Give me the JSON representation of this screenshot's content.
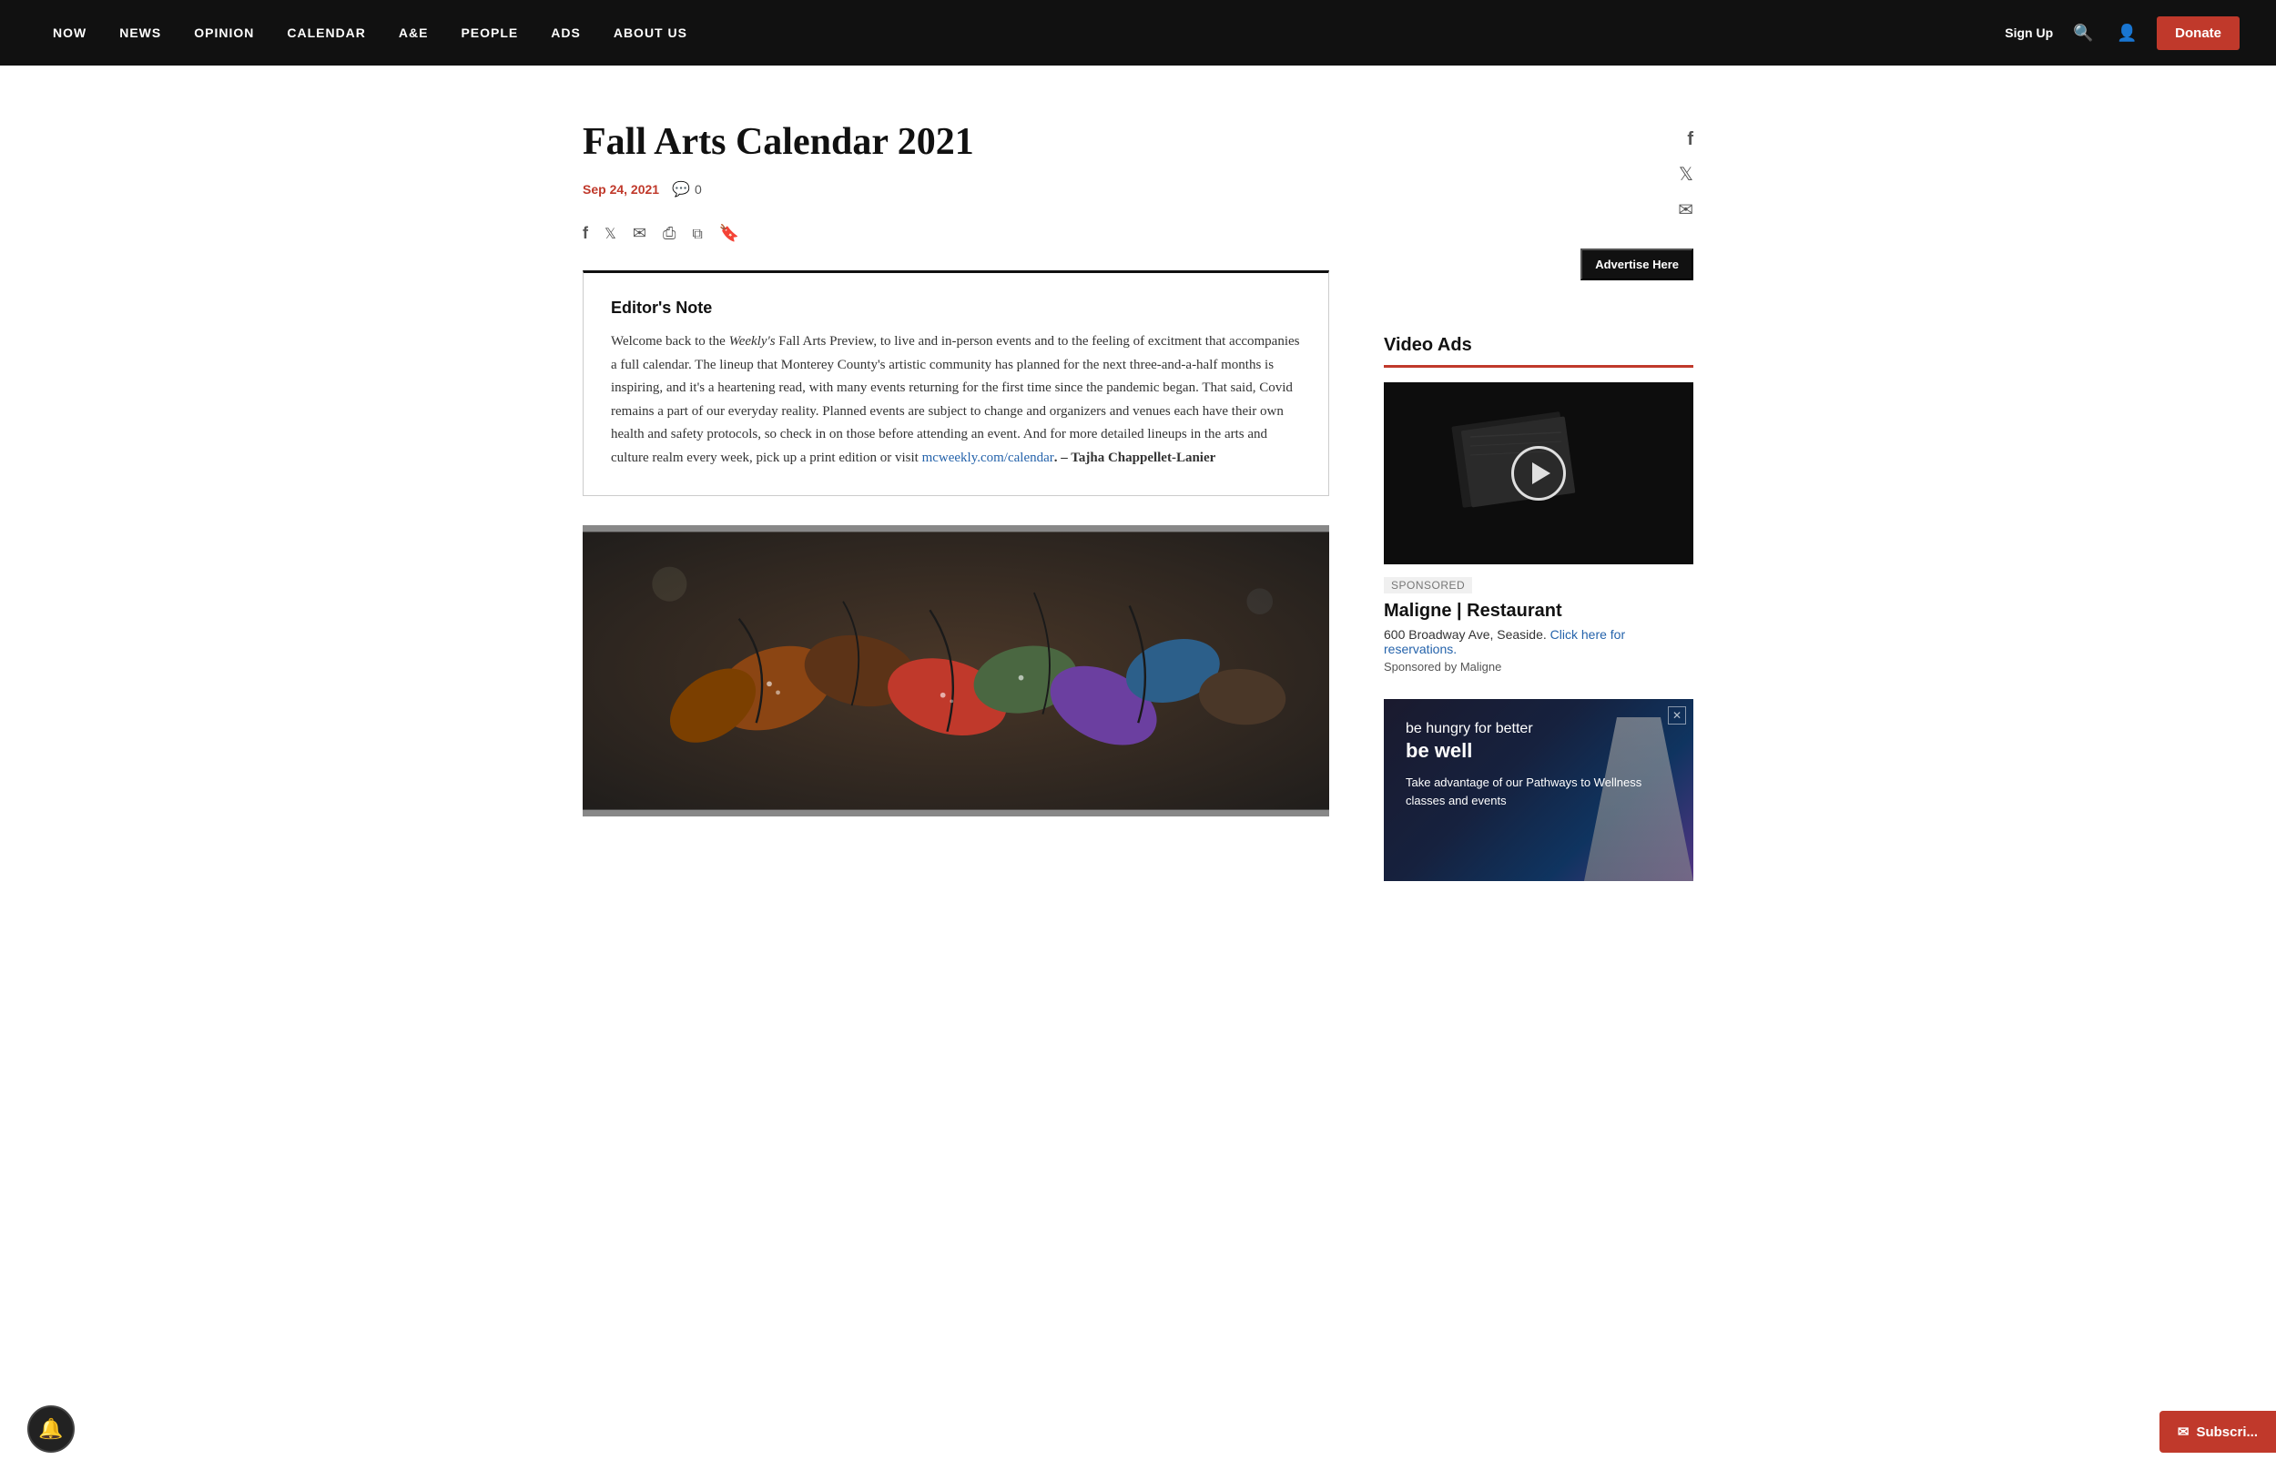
{
  "nav": {
    "links": [
      {
        "id": "now",
        "label": "NOW"
      },
      {
        "id": "news",
        "label": "NEWS"
      },
      {
        "id": "opinion",
        "label": "OPINION"
      },
      {
        "id": "calendar",
        "label": "CALENDAR"
      },
      {
        "id": "ae",
        "label": "A&E"
      },
      {
        "id": "people",
        "label": "PEOPLE"
      },
      {
        "id": "ads",
        "label": "ADS"
      },
      {
        "id": "about",
        "label": "ABOUT US"
      }
    ],
    "sign_up": "Sign Up",
    "donate": "Donate"
  },
  "article": {
    "title": "Fall Arts Calendar 2021",
    "date": "Sep 24, 2021",
    "comments_count": "0",
    "editor_note": {
      "title": "Editor's Note",
      "body_start": "Welcome back to the ",
      "publication": "Weekly's",
      "body_middle": " Fall Arts Preview, to live and in-person events and to the feeling of excitment that accompanies a full calendar. The lineup that Monterey County's artistic community has planned for the next three-and-a-half months is inspiring, and it's a heartening read, with many events returning for the first time since the pandemic began. That said, Covid remains a part of our everyday reality. Planned events are subject to change and organizers and venues each have their own health and safety protocols, so check in on those before attending an event. And for more detailed lineups in the arts and culture realm every week, pick up a print edition or visit ",
      "link_text": "mcweekly.com/calendar",
      "link_url": "http://mcweekly.com/calendar",
      "body_end": ". – Tajha Chappellet-Lanier"
    }
  },
  "sidebar": {
    "advertise_here": "Advertise Here",
    "video_ads": {
      "title": "Video Ads",
      "sponsored_label": "SPONSORED",
      "restaurant_name": "Maligne | Restaurant",
      "restaurant_address": "600 Broadway Ave, Seaside.",
      "reservation_link": "Click here for reservations.",
      "sponsored_by": "Sponsored by Maligne"
    },
    "second_ad": {
      "line1": "be hungry for better",
      "line2": "be well",
      "line3": "Take advantage of our Pathways to Wellness classes and events"
    }
  },
  "subscribe_btn": "Subscri...",
  "icons": {
    "facebook": "f",
    "twitter": "t",
    "email": "✉",
    "print": "⎙",
    "copy": "⧉",
    "bookmark": "🔖",
    "search": "🔍",
    "user": "👤",
    "bell": "🔔",
    "play": "▶",
    "mail": "✉"
  }
}
